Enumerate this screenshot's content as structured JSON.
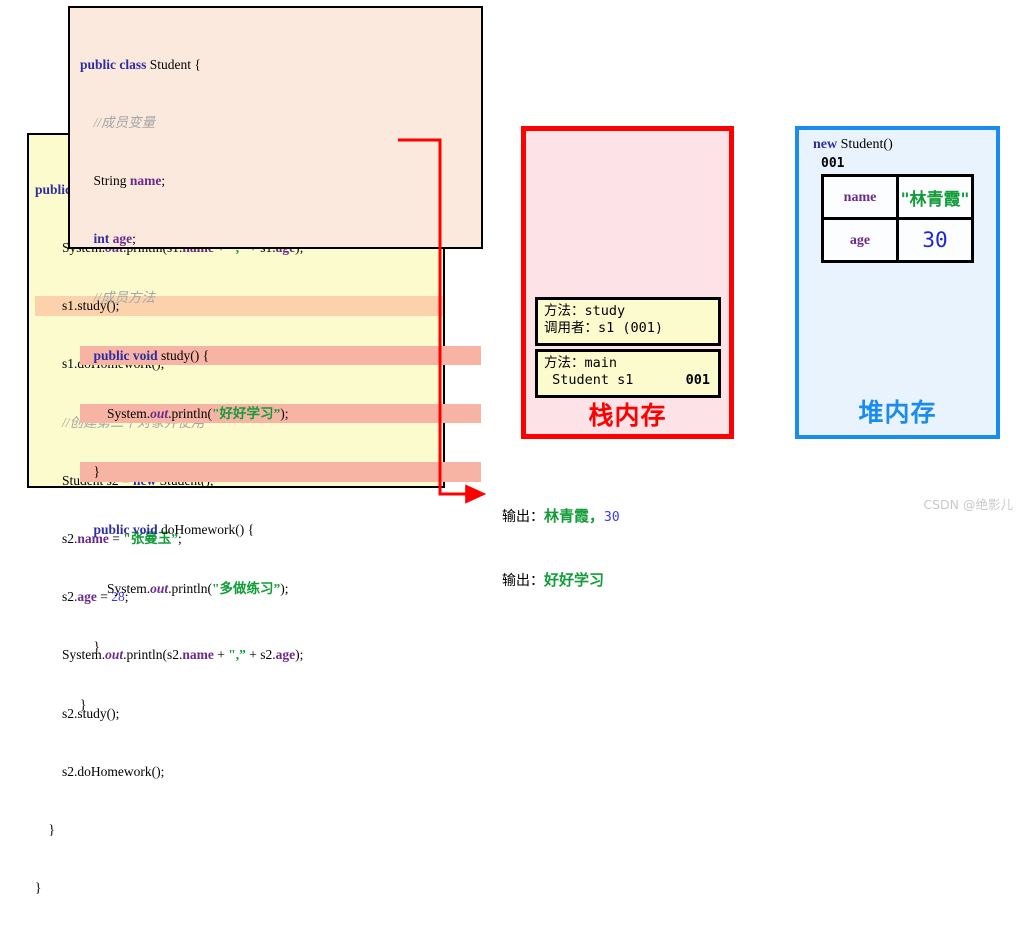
{
  "student_code": {
    "lines": [
      "public class Student {",
      "    //成员变量",
      "    String name;",
      "    int age;",
      "    //成员方法",
      "    public void study() {",
      "        System.out.println(\"好好学习\");",
      "    }",
      "    public void doHomework() {",
      "        System.out.println(\"多做练习\");",
      "    }",
      "}"
    ],
    "highlighted_lines": [
      5,
      6,
      7
    ]
  },
  "main_code": {
    "lines": [
      "public",
      "        System.out.println(s1.name + \",\" + s1.age);",
      "        s1.study();",
      "        s1.doHomework();",
      "        //创建第二个对象并使用",
      "        Student s2 = new Student();",
      "        s2.name = \"张曼玉\";",
      "        s2.age = 28;",
      "        System.out.println(s2.name + \",\" + s2.age);",
      "        s2.study();",
      "        s2.doHomework();",
      "    }",
      "}"
    ],
    "highlighted_lines": [
      2
    ]
  },
  "stack": {
    "title": "栈内存",
    "border_color": "#ff0000",
    "background": "#fde3e7",
    "frames": [
      {
        "name": "frame-study",
        "line1": "方法：study",
        "line2": "调用者：s1 (001)",
        "address": ""
      },
      {
        "name": "frame-main",
        "line1": "方法：main",
        "line2": " Student s1",
        "address": "001"
      }
    ]
  },
  "heap": {
    "title": "堆内存",
    "border_color": "#1a8cf0",
    "background": "#e8f3fd",
    "new_keyword": "new",
    "new_expr": " Student()",
    "address": "001",
    "fields": [
      {
        "key": "name",
        "value": "\"林青霞\"",
        "type": "string"
      },
      {
        "key": "age",
        "value": "30",
        "type": "number"
      }
    ]
  },
  "output": {
    "line1_label": "输出：",
    "line1_value": "林青霞，",
    "line1_number": "30",
    "line2_label": "输出：",
    "line2_value": "好好学习"
  },
  "watermark": "CSDN @绝影儿"
}
